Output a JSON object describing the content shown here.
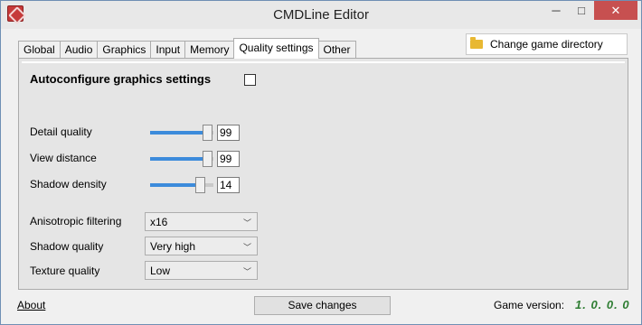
{
  "window": {
    "title": "CMDLine Editor",
    "minimize": "─",
    "maximize": "□",
    "close": "✕"
  },
  "tabs": [
    {
      "label": "Global",
      "active": false
    },
    {
      "label": "Audio",
      "active": false
    },
    {
      "label": "Graphics",
      "active": false
    },
    {
      "label": "Input",
      "active": false
    },
    {
      "label": "Memory",
      "active": false
    },
    {
      "label": "Quality settings",
      "active": true
    },
    {
      "label": "Other",
      "active": false
    }
  ],
  "change_dir": {
    "label": "Change game directory",
    "icon": "folder-icon"
  },
  "autoconfigure": {
    "label": "Autoconfigure graphics settings",
    "checked": false
  },
  "sliders": [
    {
      "label": "Detail quality",
      "value": "99",
      "fraction": 0.98
    },
    {
      "label": "View distance",
      "value": "99",
      "fraction": 0.98
    },
    {
      "label": "Shadow density",
      "value": "14",
      "fraction": 0.84
    }
  ],
  "combos": [
    {
      "label": "Anisotropic filtering",
      "value": "x16"
    },
    {
      "label": "Shadow quality",
      "value": "Very high"
    },
    {
      "label": "Texture quality",
      "value": "Low"
    }
  ],
  "footer": {
    "about": "About",
    "save": "Save changes",
    "version_label": "Game version:",
    "version_value": "1. 0. 0. 0"
  },
  "colors": {
    "accent": "#3c8bdb",
    "version": "#2e7d32",
    "close": "#c75050"
  }
}
